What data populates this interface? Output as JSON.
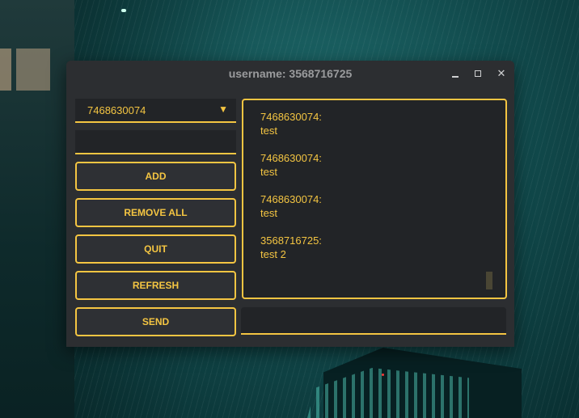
{
  "window": {
    "title": "username: 3568716725"
  },
  "contact_select": {
    "selected": "7468630074"
  },
  "buttons": {
    "add": "ADD",
    "remove_all": "REMOVE ALL",
    "quit": "QUIT",
    "refresh": "REFRESH",
    "send": "SEND"
  },
  "messages": [
    {
      "sender": "7468630074:",
      "text": "test"
    },
    {
      "sender": "7468630074:",
      "text": "test"
    },
    {
      "sender": "7468630074:",
      "text": "test"
    },
    {
      "sender": "3568716725:",
      "text": "test 2"
    }
  ],
  "inputs": {
    "contact_input_value": "",
    "message_input_value": ""
  },
  "icons": {
    "dropdown": "triangle-down",
    "minimize": "minimize-icon",
    "maximize": "maximize-icon",
    "close": "close-icon"
  },
  "colors": {
    "accent": "#f4c542",
    "window_bg": "#2c2e31",
    "field_bg": "#222427"
  }
}
